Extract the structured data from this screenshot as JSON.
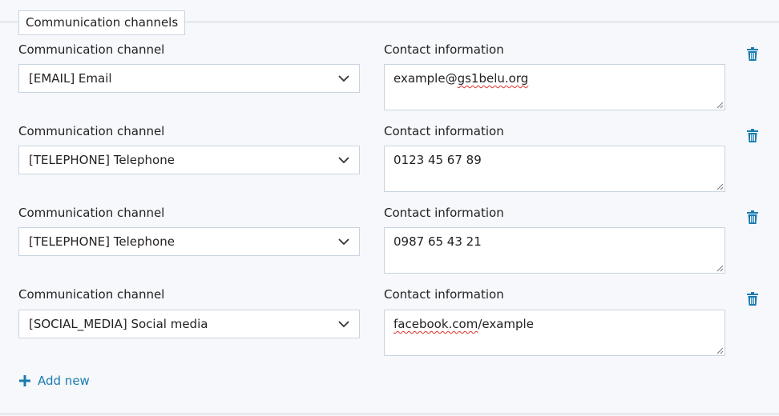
{
  "fieldset": {
    "legend": "Communication channels"
  },
  "rows": [
    {
      "channel_label": "Communication channel",
      "channel_value": "[EMAIL] Email",
      "contact_label": "Contact information",
      "contact_prefix": "example@",
      "contact_misspelled": "gs1belu.org",
      "contact_suffix": ""
    },
    {
      "channel_label": "Communication channel",
      "channel_value": "[TELEPHONE] Telephone",
      "contact_label": "Contact information",
      "contact_prefix": "0123 45 67 89",
      "contact_misspelled": "",
      "contact_suffix": ""
    },
    {
      "channel_label": "Communication channel",
      "channel_value": "[TELEPHONE] Telephone",
      "contact_label": "Contact information",
      "contact_prefix": "0987 65 43 21",
      "contact_misspelled": "",
      "contact_suffix": ""
    },
    {
      "channel_label": "Communication channel",
      "channel_value": "[SOCIAL_MEDIA] Social media",
      "contact_label": "Contact information",
      "contact_prefix": "",
      "contact_misspelled": "facebook.com",
      "contact_suffix": "/example"
    }
  ],
  "add_new": {
    "label": "Add new"
  },
  "icons": {
    "trash": "trash-icon",
    "chevron": "chevron-down-icon",
    "plus": "plus-icon"
  },
  "colors": {
    "accent": "#1a7bb0",
    "border": "#c8d4e0",
    "background": "#f6f8fb",
    "spellcheck": "#e0302a"
  }
}
